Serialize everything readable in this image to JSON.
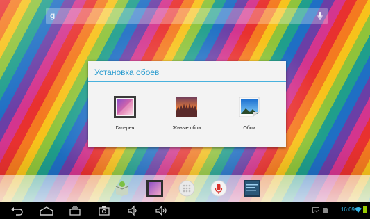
{
  "dialog": {
    "title": "Установка обоев",
    "options": [
      {
        "label": "Галерея",
        "icon": "gallery-icon"
      },
      {
        "label": "Живые обои",
        "icon": "live-wallpapers-icon"
      },
      {
        "label": "Обои",
        "icon": "wallpapers-icon"
      }
    ]
  },
  "search": {
    "google_mark": "g",
    "icon": "mic-icon"
  },
  "dock": {
    "items": [
      {
        "icon": "app-store-icon"
      },
      {
        "icon": "gallery-app-icon"
      },
      {
        "icon": "all-apps-icon"
      },
      {
        "icon": "voice-search-icon"
      },
      {
        "icon": "tasks-icon"
      }
    ]
  },
  "status_bar": {
    "time": "16:09",
    "accent_color": "#33b5e5",
    "battery_color": "#99cc00"
  },
  "colors": {
    "dialog_accent": "#2b9ccf"
  }
}
